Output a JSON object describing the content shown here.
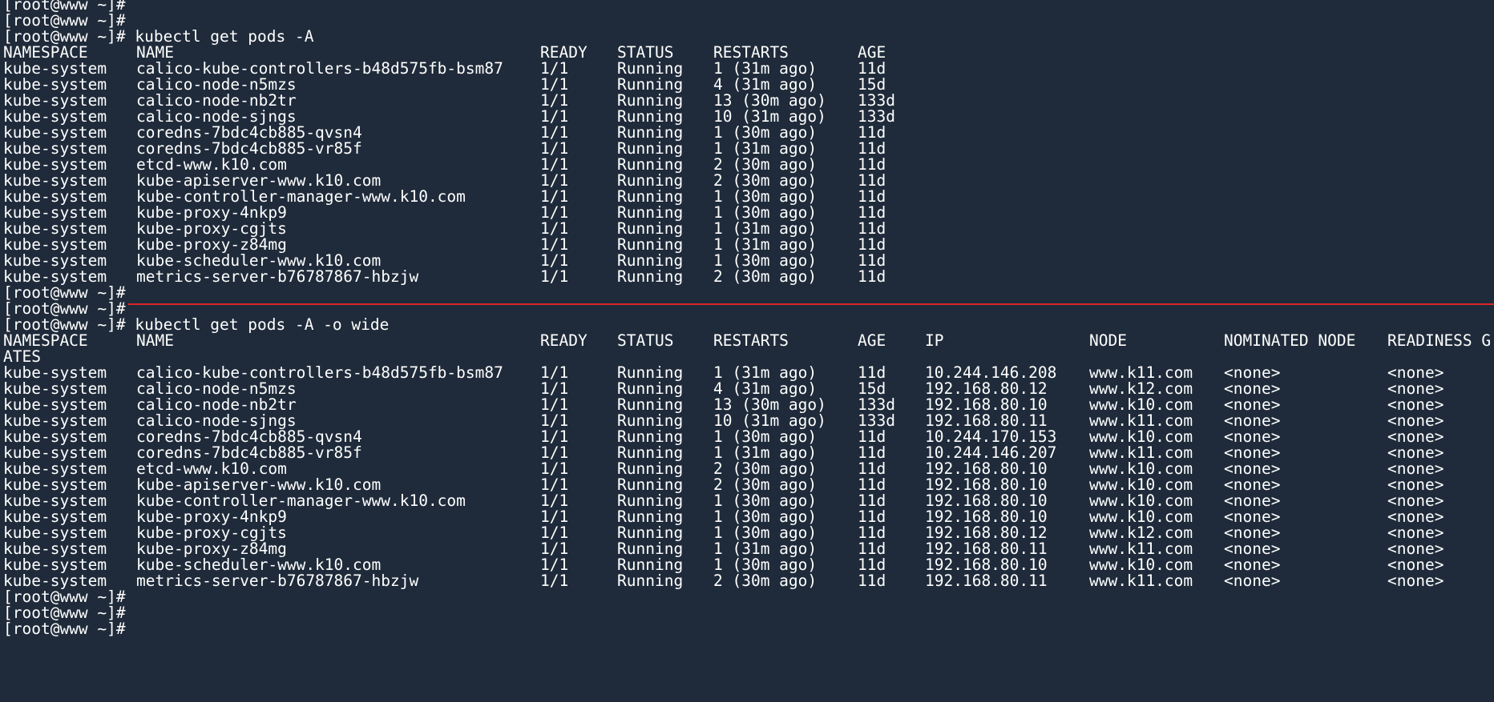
{
  "theme": {
    "background": "#1f2b3a",
    "foreground": "#ffffff",
    "divider": "#e0242b"
  },
  "prompt": "[root@www ~]#",
  "commands": {
    "get_pods": "kubectl get pods -A",
    "get_pods_wide": "kubectl get pods -A -o wide"
  },
  "table1": {
    "headers": [
      "NAMESPACE",
      "NAME",
      "READY",
      "STATUS",
      "RESTARTS",
      "AGE"
    ],
    "rows": [
      [
        "kube-system",
        "calico-kube-controllers-b48d575fb-bsm87",
        "1/1",
        "Running",
        "1 (31m ago)",
        "11d"
      ],
      [
        "kube-system",
        "calico-node-n5mzs",
        "1/1",
        "Running",
        "4 (31m ago)",
        "15d"
      ],
      [
        "kube-system",
        "calico-node-nb2tr",
        "1/1",
        "Running",
        "13 (30m ago)",
        "133d"
      ],
      [
        "kube-system",
        "calico-node-sjngs",
        "1/1",
        "Running",
        "10 (31m ago)",
        "133d"
      ],
      [
        "kube-system",
        "coredns-7bdc4cb885-qvsn4",
        "1/1",
        "Running",
        "1 (30m ago)",
        "11d"
      ],
      [
        "kube-system",
        "coredns-7bdc4cb885-vr85f",
        "1/1",
        "Running",
        "1 (31m ago)",
        "11d"
      ],
      [
        "kube-system",
        "etcd-www.k10.com",
        "1/1",
        "Running",
        "2 (30m ago)",
        "11d"
      ],
      [
        "kube-system",
        "kube-apiserver-www.k10.com",
        "1/1",
        "Running",
        "2 (30m ago)",
        "11d"
      ],
      [
        "kube-system",
        "kube-controller-manager-www.k10.com",
        "1/1",
        "Running",
        "1 (30m ago)",
        "11d"
      ],
      [
        "kube-system",
        "kube-proxy-4nkp9",
        "1/1",
        "Running",
        "1 (30m ago)",
        "11d"
      ],
      [
        "kube-system",
        "kube-proxy-cgjts",
        "1/1",
        "Running",
        "1 (31m ago)",
        "11d"
      ],
      [
        "kube-system",
        "kube-proxy-z84mg",
        "1/1",
        "Running",
        "1 (31m ago)",
        "11d"
      ],
      [
        "kube-system",
        "kube-scheduler-www.k10.com",
        "1/1",
        "Running",
        "1 (30m ago)",
        "11d"
      ],
      [
        "kube-system",
        "metrics-server-b76787867-hbzjw",
        "1/1",
        "Running",
        "2 (30m ago)",
        "11d"
      ]
    ]
  },
  "table2": {
    "headers": [
      "NAMESPACE",
      "NAME",
      "READY",
      "STATUS",
      "RESTARTS",
      "AGE",
      "IP",
      "NODE",
      "NOMINATED NODE",
      "READINESS G"
    ],
    "wrap": "ATES",
    "rows": [
      [
        "kube-system",
        "calico-kube-controllers-b48d575fb-bsm87",
        "1/1",
        "Running",
        "1 (31m ago)",
        "11d",
        "10.244.146.208",
        "www.k11.com",
        "<none>",
        "<none>"
      ],
      [
        "kube-system",
        "calico-node-n5mzs",
        "1/1",
        "Running",
        "4 (31m ago)",
        "15d",
        "192.168.80.12",
        "www.k12.com",
        "<none>",
        "<none>"
      ],
      [
        "kube-system",
        "calico-node-nb2tr",
        "1/1",
        "Running",
        "13 (30m ago)",
        "133d",
        "192.168.80.10",
        "www.k10.com",
        "<none>",
        "<none>"
      ],
      [
        "kube-system",
        "calico-node-sjngs",
        "1/1",
        "Running",
        "10 (31m ago)",
        "133d",
        "192.168.80.11",
        "www.k11.com",
        "<none>",
        "<none>"
      ],
      [
        "kube-system",
        "coredns-7bdc4cb885-qvsn4",
        "1/1",
        "Running",
        "1 (30m ago)",
        "11d",
        "10.244.170.153",
        "www.k10.com",
        "<none>",
        "<none>"
      ],
      [
        "kube-system",
        "coredns-7bdc4cb885-vr85f",
        "1/1",
        "Running",
        "1 (31m ago)",
        "11d",
        "10.244.146.207",
        "www.k11.com",
        "<none>",
        "<none>"
      ],
      [
        "kube-system",
        "etcd-www.k10.com",
        "1/1",
        "Running",
        "2 (30m ago)",
        "11d",
        "192.168.80.10",
        "www.k10.com",
        "<none>",
        "<none>"
      ],
      [
        "kube-system",
        "kube-apiserver-www.k10.com",
        "1/1",
        "Running",
        "2 (30m ago)",
        "11d",
        "192.168.80.10",
        "www.k10.com",
        "<none>",
        "<none>"
      ],
      [
        "kube-system",
        "kube-controller-manager-www.k10.com",
        "1/1",
        "Running",
        "1 (30m ago)",
        "11d",
        "192.168.80.10",
        "www.k10.com",
        "<none>",
        "<none>"
      ],
      [
        "kube-system",
        "kube-proxy-4nkp9",
        "1/1",
        "Running",
        "1 (30m ago)",
        "11d",
        "192.168.80.10",
        "www.k10.com",
        "<none>",
        "<none>"
      ],
      [
        "kube-system",
        "kube-proxy-cgjts",
        "1/1",
        "Running",
        "1 (30m ago)",
        "11d",
        "192.168.80.12",
        "www.k12.com",
        "<none>",
        "<none>"
      ],
      [
        "kube-system",
        "kube-proxy-z84mg",
        "1/1",
        "Running",
        "1 (31m ago)",
        "11d",
        "192.168.80.11",
        "www.k11.com",
        "<none>",
        "<none>"
      ],
      [
        "kube-system",
        "kube-scheduler-www.k10.com",
        "1/1",
        "Running",
        "1 (30m ago)",
        "11d",
        "192.168.80.10",
        "www.k10.com",
        "<none>",
        "<none>"
      ],
      [
        "kube-system",
        "metrics-server-b76787867-hbzjw",
        "1/1",
        "Running",
        "2 (30m ago)",
        "11d",
        "192.168.80.11",
        "www.k11.com",
        "<none>",
        "<none>"
      ]
    ]
  }
}
